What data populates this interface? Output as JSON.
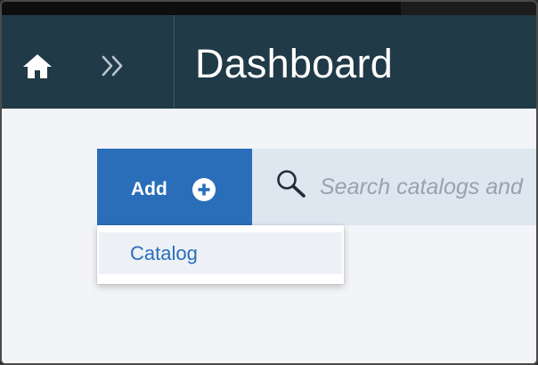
{
  "header": {
    "title": "Dashboard",
    "home_icon": "home-icon",
    "breadcrumb_icon": "double-chevron-right-icon",
    "background_color": "#213a47"
  },
  "toolbar": {
    "add_label": "Add",
    "add_icon": "plus-circle-icon",
    "accent_color": "#2a6eba"
  },
  "search": {
    "placeholder": "Search catalogs and",
    "value": "",
    "icon": "search-icon"
  },
  "dropdown": {
    "items": [
      {
        "label": "Catalog"
      }
    ]
  }
}
